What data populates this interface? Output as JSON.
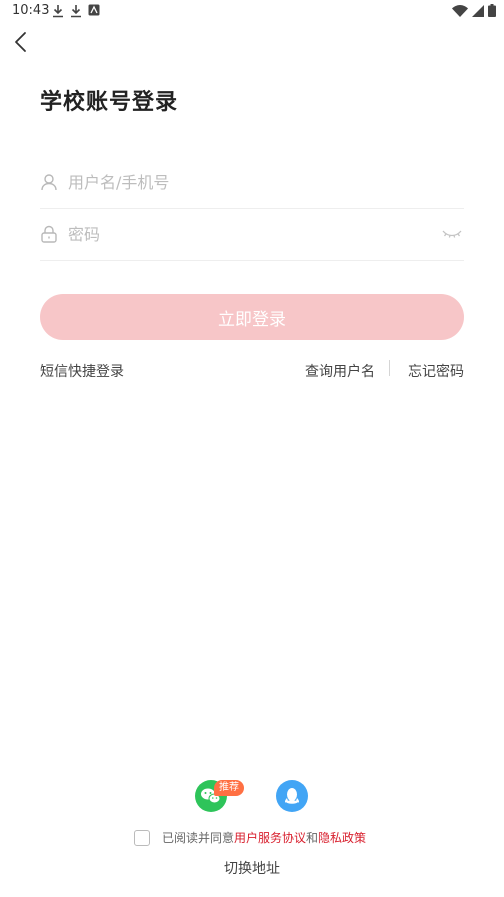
{
  "status_bar": {
    "time": "10:43"
  },
  "page": {
    "title": "学校账号登录"
  },
  "form": {
    "username_placeholder": "用户名/手机号",
    "password_placeholder": "密码",
    "login_label": "立即登录"
  },
  "links": {
    "sms_login": "短信快捷登录",
    "query_username": "查询用户名",
    "forgot_password": "忘记密码"
  },
  "social": {
    "badge": "推荐"
  },
  "agreement": {
    "prefix": "已阅读并同意",
    "service": "用户服务协议",
    "and": "和",
    "privacy": "隐私政策"
  },
  "footer": {
    "switch_address": "切换地址"
  },
  "colors": {
    "primary_disabled": "#f7c6c8",
    "link_red": "#d81e2c",
    "wechat_green": "#2ec45a",
    "qq_blue": "#42a5f5",
    "badge_orange": "#ff7043"
  }
}
